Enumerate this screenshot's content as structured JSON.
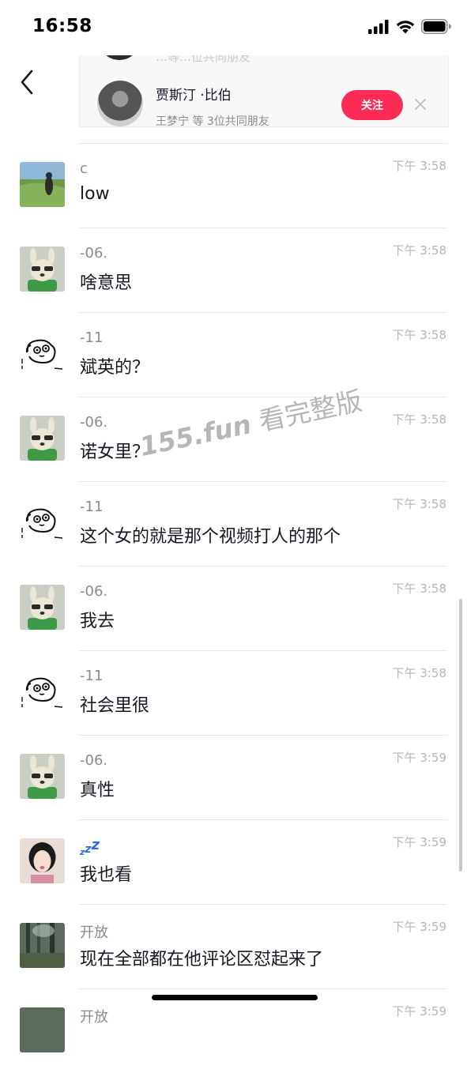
{
  "status_bar": {
    "time": "16:58"
  },
  "suggestion": {
    "previous_partial_text": "…等…位共同朋友",
    "name": "贾斯汀 ·比伯",
    "mutual": "王梦宁 等 3位共同朋友",
    "follow_label": "关注"
  },
  "messages": [
    {
      "sender": "c",
      "text": "low",
      "time": "下午 3:58",
      "avatar": "landscape-photo"
    },
    {
      "sender": "-06.",
      "text": "啥意思",
      "time": "下午 3:58",
      "avatar": "dog-mascot"
    },
    {
      "sender": "-11",
      "text": "斌英的？",
      "time": "下午 3:58",
      "avatar": "dog-sketch"
    },
    {
      "sender": "-06.",
      "text": "诺女里？",
      "time": "下午 3:58",
      "avatar": "dog-mascot"
    },
    {
      "sender": "-11",
      "text": "这个女的就是那个视频打人的那个",
      "time": "下午 3:58",
      "avatar": "dog-sketch"
    },
    {
      "sender": "-06.",
      "text": "我去",
      "time": "下午 3:58",
      "avatar": "dog-mascot"
    },
    {
      "sender": "-11",
      "text": "社会里很",
      "time": "下午 3:58",
      "avatar": "dog-sketch"
    },
    {
      "sender": "-06.",
      "text": "真性",
      "time": "下午 3:59",
      "avatar": "dog-mascot"
    },
    {
      "sender": "zzz",
      "text": "我也看",
      "time": "下午 3:59",
      "avatar": "girl-photo"
    },
    {
      "sender": "开放",
      "text": "现在全部都在他评论区怼起来了",
      "time": "下午 3:59",
      "avatar": "forest-photo"
    },
    {
      "sender": "开放",
      "text": "",
      "time": "下午 3:59",
      "avatar": "forest-photo"
    }
  ],
  "watermark": {
    "domain": "155.fun",
    "text": "看完整版"
  },
  "colors": {
    "accent": "#fe2c55",
    "text": "#161823",
    "muted": "#8a8b91",
    "time": "#b4b5b9"
  }
}
